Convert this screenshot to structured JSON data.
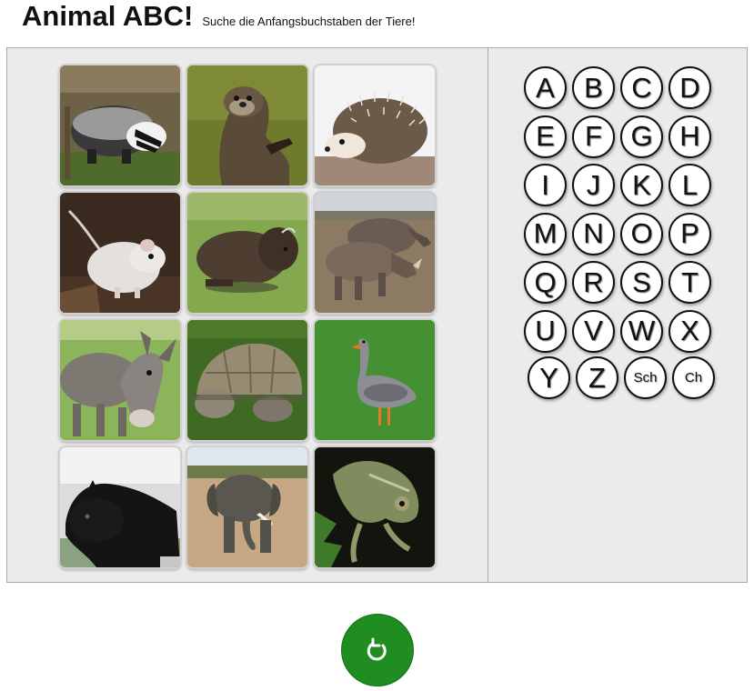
{
  "header": {
    "title": "Animal ABC!",
    "subtitle": "Suche die Anfangsbuchstaben der Tiere!"
  },
  "colors": {
    "board_background": "#ebebeb",
    "board_border": "#a8a8a8",
    "reload_button": "#1f8d1f"
  },
  "animal_cards": [
    {
      "animal": "badger"
    },
    {
      "animal": "otter"
    },
    {
      "animal": "hedgehog"
    },
    {
      "animal": "gerbil"
    },
    {
      "animal": "bison"
    },
    {
      "animal": "rhinoceros"
    },
    {
      "animal": "donkey"
    },
    {
      "animal": "tortoise"
    },
    {
      "animal": "goose"
    },
    {
      "animal": "black-panther"
    },
    {
      "animal": "elephant"
    },
    {
      "animal": "chameleon"
    }
  ],
  "letters": [
    "A",
    "B",
    "C",
    "D",
    "E",
    "F",
    "G",
    "H",
    "I",
    "J",
    "K",
    "L",
    "M",
    "N",
    "O",
    "P",
    "Q",
    "R",
    "S",
    "T",
    "U",
    "V",
    "W",
    "X",
    "Y",
    "Z",
    "Sch",
    "Ch"
  ],
  "reload_button": {
    "icon": "reload-icon",
    "symbol": "↺"
  }
}
